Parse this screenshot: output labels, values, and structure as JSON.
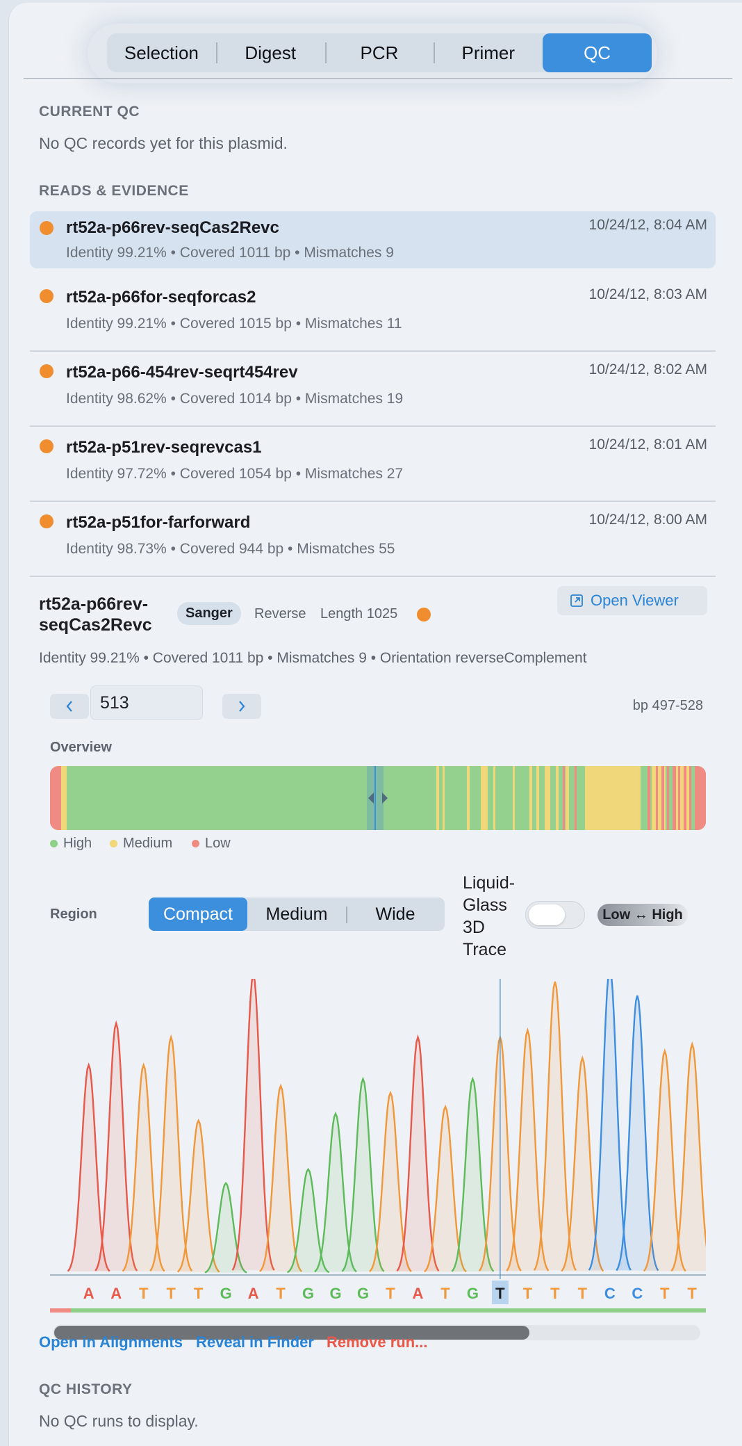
{
  "tabs": [
    {
      "label": "Selection",
      "selected": false
    },
    {
      "label": "Digest",
      "selected": false
    },
    {
      "label": "PCR",
      "selected": false
    },
    {
      "label": "Primer",
      "selected": false
    },
    {
      "label": "QC",
      "selected": true
    }
  ],
  "current_qc": {
    "heading": "CURRENT QC",
    "empty_text": "No QC records yet for this plasmid."
  },
  "reads": {
    "heading": "READS & EVIDENCE",
    "items": [
      {
        "name": "rt52a-p66rev-seqCas2Revc",
        "meta": "Identity 99.21% • Covered 1011 bp • Mismatches 9",
        "time": "10/24/12, 8:04 AM",
        "status_color": "#f08d2e"
      },
      {
        "name": "rt52a-p66for-seqforcas2",
        "meta": "Identity 99.21% • Covered 1015 bp • Mismatches 11",
        "time": "10/24/12, 8:03 AM",
        "status_color": "#f08d2e"
      },
      {
        "name": "rt52a-p66-454rev-seqrt454rev",
        "meta": "Identity 98.62% • Covered 1014 bp • Mismatches 19",
        "time": "10/24/12, 8:02 AM",
        "status_color": "#f08d2e"
      },
      {
        "name": "rt52a-p51rev-seqrevcas1",
        "meta": "Identity 97.72% • Covered 1054 bp • Mismatches 27",
        "time": "10/24/12, 8:01 AM",
        "status_color": "#f08d2e"
      },
      {
        "name": "rt52a-p51for-farforward",
        "meta": "Identity 98.73% • Covered 944 bp • Mismatches 55",
        "time": "10/24/12, 8:00 AM",
        "status_color": "#f08d2e"
      }
    ]
  },
  "detail": {
    "name_line1": "rt52a-p66rev-",
    "name_line2": "seqCas2Revc",
    "badge": "Sanger",
    "direction": "Reverse",
    "length": "Length 1025",
    "open_viewer": "Open Viewer",
    "summary": "Identity 99.21% • Covered 1011 bp • Mismatches 9 • Orientation reverseComplement",
    "position_value": "513",
    "bp_range": "bp 497-528",
    "overview_label": "Overview",
    "legend": [
      {
        "label": "High",
        "color": "#8fd089"
      },
      {
        "label": "Medium",
        "color": "#f0d77a"
      },
      {
        "label": "Low",
        "color": "#ef8b82"
      }
    ],
    "region_label": "Region",
    "region_options": [
      {
        "label": "Compact",
        "selected": true
      },
      {
        "label": "Medium",
        "selected": false
      },
      {
        "label": "Wide",
        "selected": false
      }
    ],
    "trace_label": [
      "Liquid-",
      "Glass",
      "3D",
      "Trace"
    ],
    "trace_toggle_on": false,
    "contrast_label": "Low ↔ High",
    "bases": [
      "A",
      "A",
      "T",
      "T",
      "T",
      "G",
      "A",
      "T",
      "G",
      "G",
      "G",
      "T",
      "A",
      "T",
      "G",
      "T",
      "T",
      "T",
      "T",
      "C",
      "C",
      "T",
      "T"
    ],
    "highlighted_base_index": 15,
    "colors": {
      "A": "#e8594b",
      "T": "#f0983a",
      "G": "#5dbb5a",
      "C": "#3d8ee0"
    }
  },
  "actions": {
    "open_alignments": "Open in Alignments",
    "reveal_finder": "Reveal in Finder",
    "remove_run": "Remove run..."
  },
  "qc_history": {
    "heading": "QC HISTORY",
    "empty_text": "No QC runs to display."
  }
}
